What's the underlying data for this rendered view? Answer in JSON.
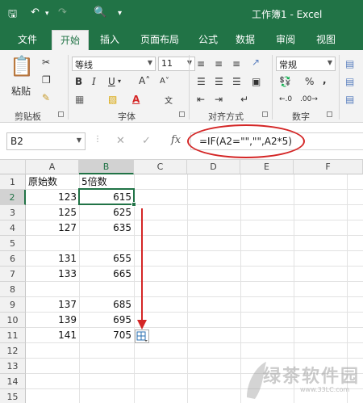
{
  "window": {
    "title": "工作簿1 - Excel"
  },
  "tabs": [
    "文件",
    "开始",
    "插入",
    "页面布局",
    "公式",
    "数据",
    "审阅",
    "视图"
  ],
  "active_tab": "开始",
  "ribbon": {
    "clipboard": {
      "paste_label": "粘贴",
      "group_label": "剪贴板"
    },
    "font": {
      "font_name": "等线",
      "font_size": "11",
      "group_label": "字体",
      "bold": "B",
      "italic": "I",
      "underline": "U"
    },
    "alignment": {
      "group_label": "对齐方式"
    },
    "number": {
      "format": "常规",
      "group_label": "数字",
      "percent": "%",
      "comma": ","
    }
  },
  "formula_bar": {
    "name_box": "B2",
    "formula": "=IF(A2=\"\",\"\",A2*5)",
    "fx_label": "fx"
  },
  "grid": {
    "columns": [
      "A",
      "B",
      "C",
      "D",
      "E",
      "F"
    ],
    "rows": [
      "1",
      "2",
      "3",
      "4",
      "5",
      "6",
      "7",
      "8",
      "9",
      "10",
      "11",
      "12",
      "13",
      "14",
      "15"
    ],
    "cells": {
      "A1": "原始数",
      "B1": "5倍数",
      "A2": "123",
      "B2": "615",
      "A3": "125",
      "B3": "625",
      "A4": "127",
      "B4": "635",
      "A6": "131",
      "B6": "655",
      "A7": "133",
      "B7": "665",
      "A9": "137",
      "B9": "685",
      "A10": "139",
      "B10": "695",
      "A11": "141",
      "B11": "705"
    },
    "selected_cell": "B2"
  },
  "watermark": {
    "text": "绿茶软件园",
    "url": "www.33LC.com"
  },
  "colors": {
    "excel_green": "#217346",
    "annotation_red": "#d42626"
  }
}
